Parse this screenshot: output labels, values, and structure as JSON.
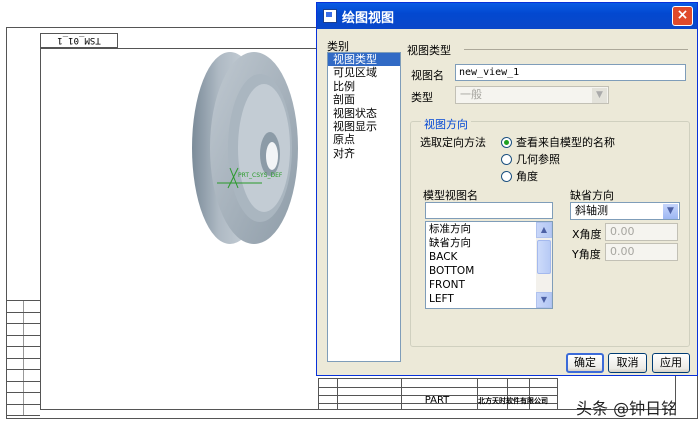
{
  "sheet": {
    "frame_label": "TSM_01_1",
    "part_label": "PART",
    "company": "北方天时软件有限公司",
    "watermark": "头条 @钟日铭",
    "model_label": "PRT_CSYS_DEF"
  },
  "dialog": {
    "title": "绘图视图",
    "close_icon": "close-icon",
    "categories_title": "类别",
    "categories": [
      "视图类型",
      "可见区域",
      "比例",
      "剖面",
      "视图状态",
      "视图显示",
      "原点",
      "对齐"
    ],
    "selected_category": "视图类型",
    "section_title": "视图类型",
    "view_name_label": "视图名",
    "view_name_value": "new_view_1",
    "type_label": "类型",
    "type_value": "一般",
    "orientation_group_title": "视图方向",
    "orientation_method_label": "选取定向方法",
    "orientation_options": [
      "查看来自模型的名称",
      "几何参照",
      "角度"
    ],
    "selected_orientation": "查看来自模型的名称",
    "model_views_label": "模型视图名",
    "model_views_search": "",
    "model_views": [
      "标准方向",
      "缺省方向",
      "BACK",
      "BOTTOM",
      "FRONT",
      "LEFT"
    ],
    "default_orientation_label": "缺省方向",
    "default_orientation_value": "斜轴测",
    "x_angle_label": "X角度",
    "x_angle_value": "0.00",
    "y_angle_label": "Y角度",
    "y_angle_value": "0.00",
    "ok_label": "确定",
    "cancel_label": "取消",
    "apply_label": "应用"
  },
  "colors": {
    "titlebar": "#0348d0",
    "selection": "#316ac5",
    "dialog_bg": "#ece9d8",
    "group_title": "#0046d5"
  }
}
